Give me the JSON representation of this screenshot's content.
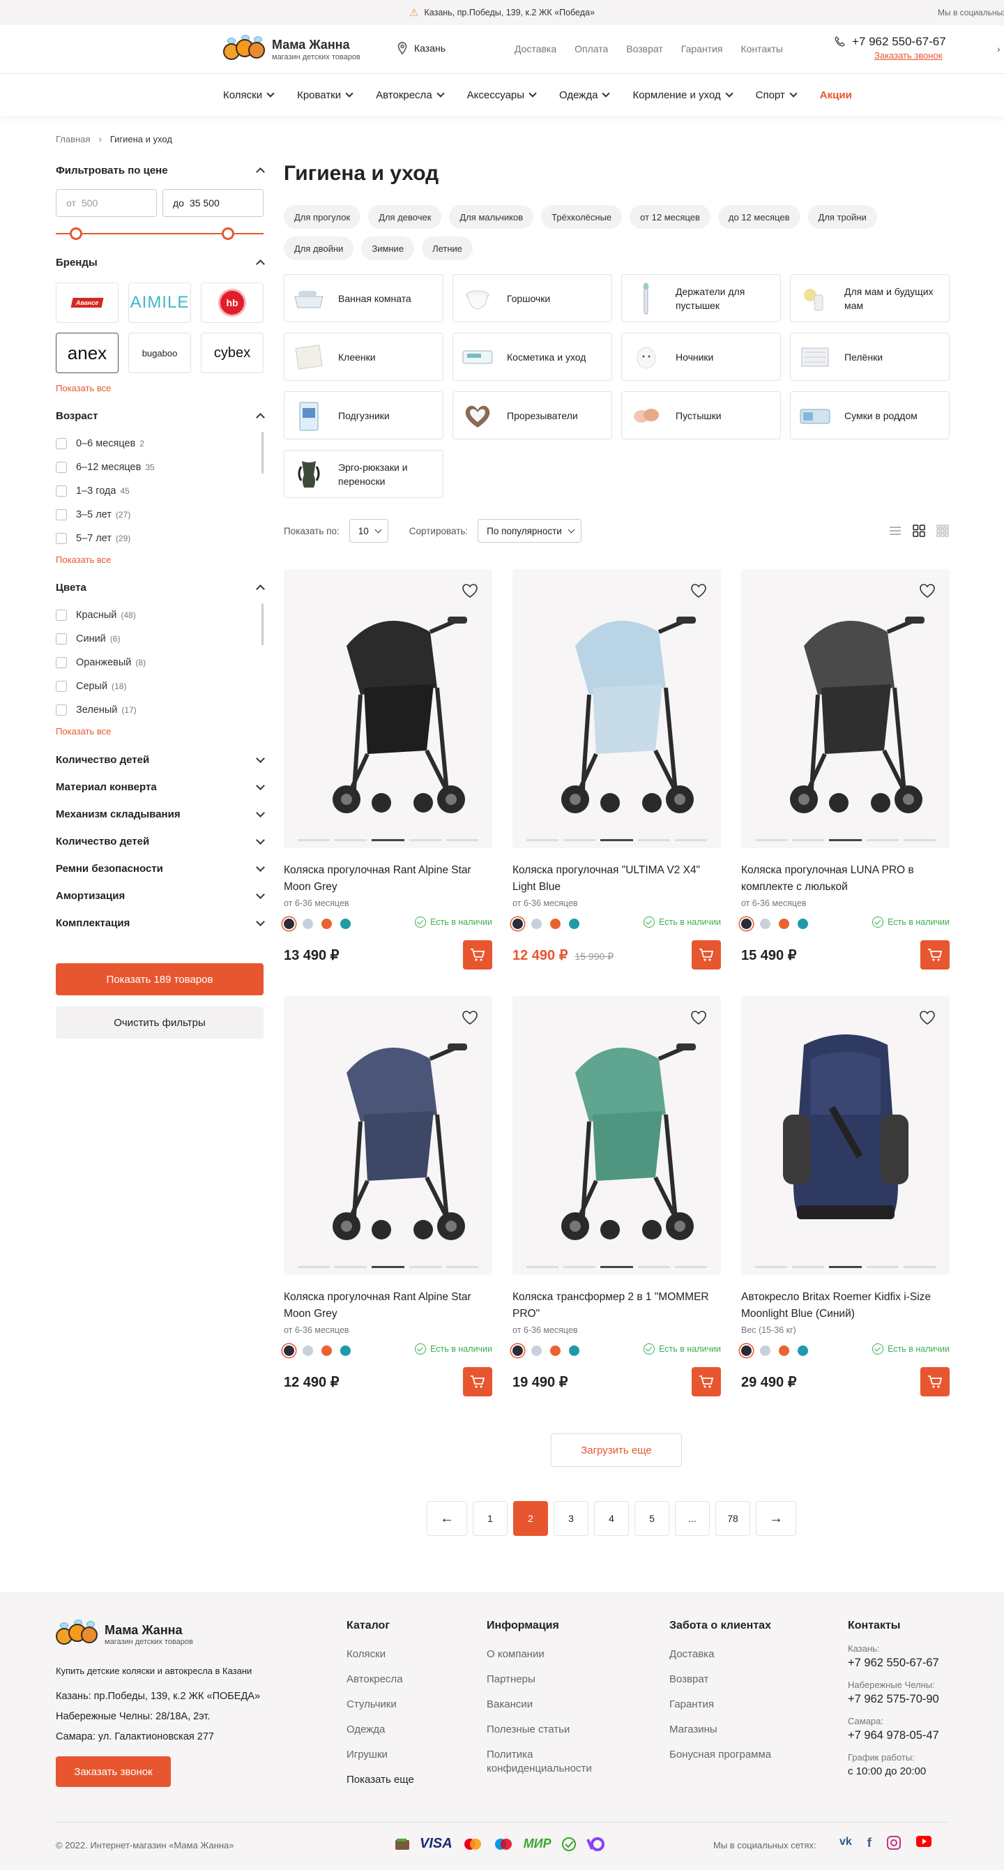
{
  "topbar": {
    "address": "Казань, пр.Победы, 139, к.2 ЖК «Победа»",
    "social": "Мы в социальных сетях"
  },
  "logo": {
    "name": "Мама Жанна",
    "tagline": "магазин детских товаров"
  },
  "header": {
    "city": "Казань",
    "nav": [
      "Доставка",
      "Оплата",
      "Возврат",
      "Гарантия",
      "Контакты"
    ],
    "phone": "+7 962 550-67-67",
    "callback": "Заказать звонок"
  },
  "catnav": [
    "Коляски",
    "Кроватки",
    "Автокресла",
    "Аксессуары",
    "Одежда",
    "Кормление и уход",
    "Спорт"
  ],
  "catnav_promo": "Акции",
  "breadcrumbs": [
    "Главная",
    "Гигиена и уход"
  ],
  "filters": {
    "price": {
      "title": "Фильтровать по цене",
      "from_label": "от",
      "from_placeholder": "500",
      "to_label": "до",
      "to_value": "35 500"
    },
    "brands": {
      "title": "Бренды",
      "items": [
        "Авансе",
        "AIMILE",
        "happy baby",
        "anex",
        "bugaboo",
        "cybex"
      ],
      "show_all": "Показать все"
    },
    "age": {
      "title": "Возраст",
      "items": [
        {
          "label": "0–6 месяцев",
          "count": "2"
        },
        {
          "label": "6–12 месяцев",
          "count": "35"
        },
        {
          "label": "1–3 года",
          "count": "45"
        },
        {
          "label": "3–5 лет",
          "count": "(27)"
        },
        {
          "label": "5–7 лет",
          "count": "(29)"
        }
      ],
      "show_all": "Показать все"
    },
    "colors": {
      "title": "Цвета",
      "items": [
        {
          "label": "Красный",
          "count": "(48)"
        },
        {
          "label": "Синий",
          "count": "(6)"
        },
        {
          "label": "Оранжевый",
          "count": "(8)"
        },
        {
          "label": "Серый",
          "count": "(18)"
        },
        {
          "label": "Зеленый",
          "count": "(17)"
        }
      ],
      "show_all": "Показать все"
    },
    "collapsed": [
      "Количество детей",
      "Материал конверта",
      "Механизм складывания",
      "Количество детей",
      "Ремни безопасности",
      "Амортизация",
      "Комплектация"
    ],
    "apply": "Показать 189 товаров",
    "clear": "Очистить фильтры"
  },
  "page": {
    "title": "Гигиена и уход"
  },
  "tags": [
    "Для прогулок",
    "Для девочек",
    "Для мальчиков",
    "Трёхколёсные",
    "от 12 месяцев",
    "до 12 месяцев",
    "Для тройни",
    "Для двойни",
    "Зимние",
    "Летние"
  ],
  "categories": [
    {
      "label": "Ванная комната",
      "icon": "bathtub-icon"
    },
    {
      "label": "Горшочки",
      "icon": "potty-icon"
    },
    {
      "label": "Держатели для пустышек",
      "icon": "pacifier-holder-icon"
    },
    {
      "label": "Для мам и будущих мам",
      "icon": "breast-pump-icon"
    },
    {
      "label": "Клеенки",
      "icon": "oilcloth-icon"
    },
    {
      "label": "Косметика и уход",
      "icon": "cosmetics-icon"
    },
    {
      "label": "Ночники",
      "icon": "nightlight-icon"
    },
    {
      "label": "Пелёнки",
      "icon": "diapers-icon"
    },
    {
      "label": "Подгузники",
      "icon": "nappies-icon"
    },
    {
      "label": "Прорезыватели",
      "icon": "teether-icon"
    },
    {
      "label": "Пустышки",
      "icon": "pacifier-icon"
    },
    {
      "label": "Сумки в роддом",
      "icon": "bag-icon"
    },
    {
      "label": "Эрго-рюкзаки и переноски",
      "icon": "carrier-icon"
    }
  ],
  "toolbar": {
    "show_label": "Показать по:",
    "show_value": "10",
    "sort_label": "Сортировать:",
    "sort_value": "По популярности"
  },
  "products": [
    {
      "name": "Коляска прогулочная Rant Alpine Star Moon Grey",
      "sub": "от 6-36 месяцев",
      "stock": "Есть в наличии",
      "price": "13 490 ₽",
      "old": "",
      "sale": false,
      "kind": "stroller",
      "hood": "#2b2b2b",
      "seat": "#1e1e1e"
    },
    {
      "name": "Коляска прогулочная \"ULTIMA V2 X4\" Light Blue",
      "sub": "от 6-36 месяцев",
      "stock": "Есть в наличии",
      "price": "12 490 ₽",
      "old": "15 990 ₽",
      "sale": true,
      "kind": "stroller",
      "hood": "#b9d4e4",
      "seat": "#c7dbe8"
    },
    {
      "name": "Коляска прогулочная LUNA PRO в комплекте с люлькой",
      "sub": "от 6-36 месяцев",
      "stock": "Есть в наличии",
      "price": "15 490 ₽",
      "old": "",
      "sale": false,
      "kind": "stroller",
      "hood": "#4a4a4a",
      "seat": "#2f2f2f"
    },
    {
      "name": "Коляска прогулочная Rant Alpine Star Moon Grey",
      "sub": "от 6-36 месяцев",
      "stock": "Есть в наличии",
      "price": "12 490 ₽",
      "old": "",
      "sale": false,
      "kind": "stroller",
      "hood": "#4b5577",
      "seat": "#3d4766"
    },
    {
      "name": "Коляска трансформер 2 в 1 \"MOMMER PRO\"",
      "sub": "от 6-36 месяцев",
      "stock": "Есть в наличии",
      "price": "19 490 ₽",
      "old": "",
      "sale": false,
      "kind": "stroller",
      "hood": "#5fa58f",
      "seat": "#4f9580"
    },
    {
      "name": "Автокресло Britax Roemer Kidfix i-Size Moonlight Blue (Синий)",
      "sub": "Вес (15-36 кг)",
      "stock": "Есть в наличии",
      "price": "29 490 ₽",
      "old": "",
      "sale": false,
      "kind": "carseat",
      "hood": "#2f3a62",
      "seat": "#2a3457"
    }
  ],
  "swatches": [
    "#2b2b3a",
    "#c8d0dc",
    "#e8632f",
    "#1f9aa8"
  ],
  "load_more": "Загрузить еще",
  "pagination": [
    "1",
    "2",
    "3",
    "4",
    "5",
    "...",
    "78"
  ],
  "pagination_current": "2",
  "footer": {
    "tagline": "Купить детские коляски и автокресла в Казани",
    "addresses": [
      "Казань: пр.Победы, 139, к.2 ЖК «ПОБЕДА»",
      "Набережные Челны: 28/18А, 2эт.",
      "Самара: ул. Галактионовская 277"
    ],
    "callback": "Заказать звонок",
    "catalog": {
      "title": "Каталог",
      "items": [
        "Коляски",
        "Автокресла",
        "Стульчики",
        "Одежда",
        "Игрушки"
      ],
      "more": "Показать еще"
    },
    "info": {
      "title": "Информация",
      "items": [
        "О компании",
        "Партнеры",
        "Вакансии",
        "Полезные статьи",
        "Политика конфиденциальности"
      ]
    },
    "care": {
      "title": "Забота о клиентах",
      "items": [
        "Доставка",
        "Возврат",
        "Гарантия",
        "Магазины",
        "Бонусная программа"
      ]
    },
    "contacts": {
      "title": "Контакты",
      "items": [
        {
          "label": "Казань:",
          "value": "+7 962 550-67-67"
        },
        {
          "label": "Набережные Челны:",
          "value": "+7 962 575-70-90"
        },
        {
          "label": "Самара:",
          "value": "+7 964 978-05-47"
        },
        {
          "label": "График работы:",
          "value": "с 10:00 до 20:00"
        }
      ]
    },
    "copyright": "© 2022. Интернет-магазин «Мама Жанна»",
    "payments": [
      "wallet-icon",
      "VISA",
      "mastercard-icon",
      "maestro-icon",
      "МИР",
      "check-icon",
      "yoomoney-icon"
    ],
    "social_label": "Мы в социальных сетях:",
    "social": [
      "vk-icon",
      "facebook-icon",
      "instagram-icon",
      "youtube-icon"
    ]
  },
  "colors": {
    "accent": "#e8562f",
    "green": "#3dae52",
    "bg_soft": "#f6f4f4"
  }
}
